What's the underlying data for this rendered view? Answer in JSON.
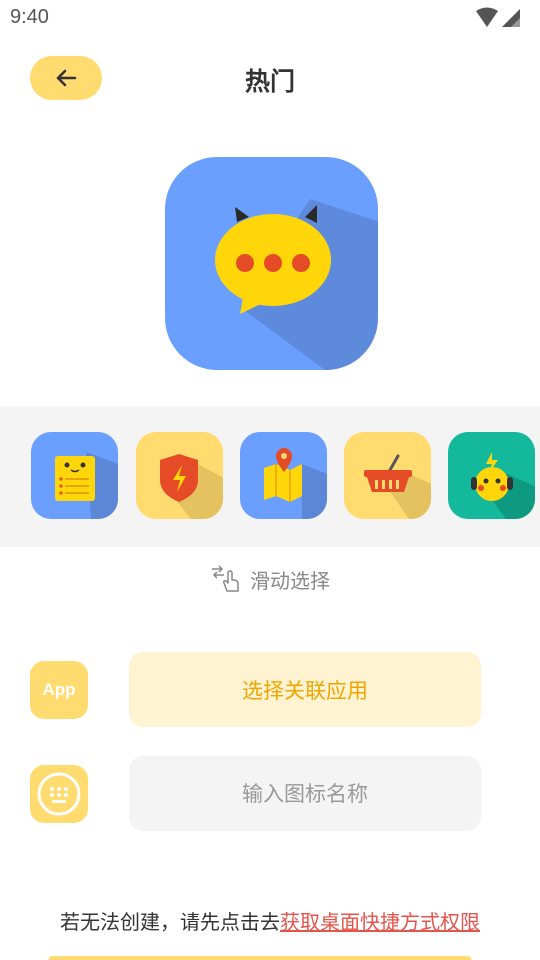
{
  "status_bar": {
    "time": "9:40",
    "wifi_icon": "wifi-icon",
    "signal_icon": "signal-icon"
  },
  "header": {
    "title": "热门",
    "back_icon": "arrow-left-icon"
  },
  "preview": {
    "icon": "chat-bubble-pikachu-icon",
    "bg_color": "#6B9FFF",
    "accent_color": "#FFD60A"
  },
  "icon_options": [
    {
      "name": "notepad-face-icon",
      "bg": "#6B9FFF"
    },
    {
      "name": "shield-bolt-icon",
      "bg": "#FFDB70"
    },
    {
      "name": "map-pin-icon",
      "bg": "#6B9FFF"
    },
    {
      "name": "basket-icon",
      "bg": "#FFDB70"
    },
    {
      "name": "pikachu-headphones-icon",
      "bg": "#14B89A"
    }
  ],
  "swipe_hint": {
    "icon": "swipe-hand-icon",
    "text": "滑动选择"
  },
  "app_row": {
    "icon_text": "App",
    "button_label": "选择关联应用"
  },
  "name_row": {
    "icon": "keyboard-icon",
    "placeholder": "输入图标名称",
    "value": ""
  },
  "footer": {
    "prefix": "若无法创建，请先点击去",
    "link": "获取桌面快捷方式权限"
  }
}
